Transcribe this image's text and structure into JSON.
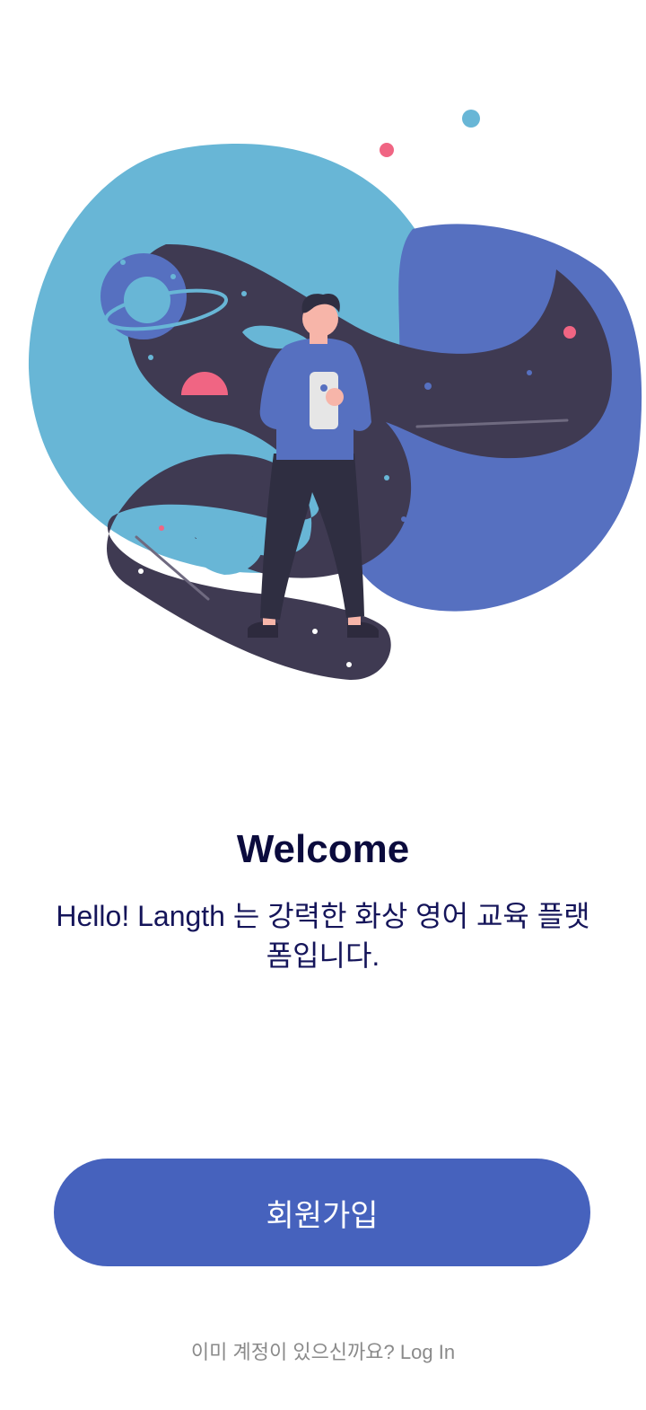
{
  "welcome": {
    "title": "Welcome",
    "subtitle": "Hello! Langth 는 강력한 화상 영어 교육 플랫폼입니다."
  },
  "actions": {
    "signup_label": "회원가입",
    "login_prompt": "이미 계정이 있으신까요?",
    "login_link": "Log In"
  },
  "colors": {
    "primary": "#4662bd",
    "title_text": "#0b0b3d",
    "blob_light": "#68b6d6",
    "blob_dark": "#5670c0",
    "space": "#3f3a52",
    "accent_pink": "#f06583"
  },
  "illustration": {
    "name": "space-person-illustration"
  }
}
